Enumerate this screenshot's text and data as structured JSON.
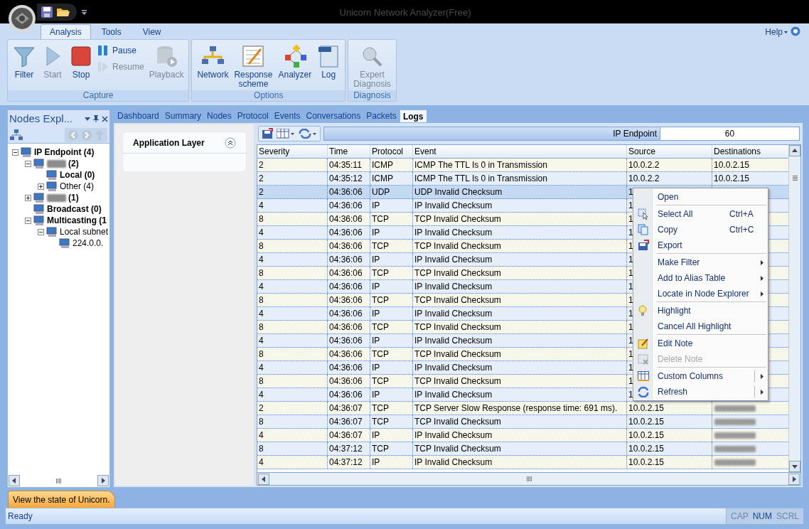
{
  "window": {
    "title": "Unicorn Network Analyzer(Free)"
  },
  "ribbon": {
    "tabs": [
      {
        "label": "Analysis",
        "selected": true
      },
      {
        "label": "Tools",
        "selected": false
      },
      {
        "label": "View",
        "selected": false
      }
    ],
    "help": "Help",
    "groups": [
      {
        "label": "Capture",
        "buttons": [
          {
            "label": "Filter",
            "kind": "large",
            "disabled": false
          },
          {
            "label": "Start",
            "kind": "large",
            "disabled": true
          },
          {
            "label": "Stop",
            "kind": "large",
            "disabled": false
          },
          {
            "label": "Pause",
            "kind": "small",
            "disabled": false
          },
          {
            "label": "Resume",
            "kind": "small",
            "disabled": true
          },
          {
            "label": "Playback",
            "kind": "large",
            "disabled": true
          }
        ]
      },
      {
        "label": "Options",
        "buttons": [
          {
            "label": "Network",
            "kind": "large",
            "disabled": false
          },
          {
            "label": "Response scheme",
            "kind": "large",
            "disabled": false
          },
          {
            "label": "Analyzer",
            "kind": "large",
            "disabled": false
          },
          {
            "label": "Log",
            "kind": "large",
            "disabled": false
          }
        ]
      },
      {
        "label": "Diagnosis",
        "buttons": [
          {
            "label": "Expert Diagnosis",
            "kind": "large",
            "disabled": true
          }
        ]
      }
    ]
  },
  "nodes_explorer": {
    "title": "Nodes Expl...",
    "tree": [
      {
        "label": "IP Endpoint (4)",
        "bold": true,
        "expanded": true,
        "children": [
          {
            "label": "(2)",
            "bold": true,
            "redacted": true,
            "expanded": true,
            "children": [
              {
                "label": "Local (0)",
                "bold": true
              },
              {
                "label": "Other (4)",
                "bold": false,
                "expanded": false
              }
            ]
          },
          {
            "label": "(1)",
            "bold": true,
            "redacted": true,
            "expanded": false
          },
          {
            "label": "Broadcast (0)",
            "bold": true
          },
          {
            "label": "Multicasting (1",
            "bold": true,
            "expanded": true,
            "children": [
              {
                "label": "Local subnet",
                "bold": false,
                "expanded": true,
                "children": [
                  {
                    "label": "224.0.0.",
                    "bold": false
                  }
                ]
              }
            ]
          }
        ]
      }
    ]
  },
  "view_tabs": [
    {
      "label": "Dashboard",
      "selected": false
    },
    {
      "label": "Summary",
      "selected": false
    },
    {
      "label": "Nodes",
      "selected": false
    },
    {
      "label": "Protocol",
      "selected": false
    },
    {
      "label": "Events",
      "selected": false
    },
    {
      "label": "Conversations",
      "selected": false
    },
    {
      "label": "Packets",
      "selected": false
    },
    {
      "label": "Logs",
      "selected": true
    }
  ],
  "side_panel": {
    "title": "Application Layer",
    "expanded": true
  },
  "logs": {
    "filter_label": "IP Endpoint",
    "filter_value": "60",
    "columns": [
      "Severity",
      "Time",
      "Protocol",
      "Event",
      "Source",
      "Destinations"
    ],
    "rows": [
      {
        "severity": "2",
        "time": "04:35:11",
        "protocol": "ICMP",
        "event": "ICMP The TTL Is 0 in Transmission",
        "source": "10.0.2.2",
        "destination": "10.0.2.15",
        "selected": false
      },
      {
        "severity": "2",
        "time": "04:35:12",
        "protocol": "ICMP",
        "event": "ICMP The TTL Is 0 in Transmission",
        "source": "10.0.2.2",
        "destination": "10.0.2.15",
        "selected": false
      },
      {
        "severity": "2",
        "time": "04:36:06",
        "protocol": "UDP",
        "event": "UDP Invalid Checksum",
        "source": "1",
        "selected": true
      },
      {
        "severity": "4",
        "time": "04:36:06",
        "protocol": "IP",
        "event": "IP Invalid Checksum",
        "source": "1",
        "selected": false
      },
      {
        "severity": "8",
        "time": "04:36:06",
        "protocol": "TCP",
        "event": "TCP Invalid Checksum",
        "source": "1",
        "selected": false
      },
      {
        "severity": "4",
        "time": "04:36:06",
        "protocol": "IP",
        "event": "IP Invalid Checksum",
        "source": "1",
        "selected": false
      },
      {
        "severity": "8",
        "time": "04:36:06",
        "protocol": "TCP",
        "event": "TCP Invalid Checksum",
        "source": "1",
        "selected": false
      },
      {
        "severity": "4",
        "time": "04:36:06",
        "protocol": "IP",
        "event": "IP Invalid Checksum",
        "source": "1",
        "selected": false
      },
      {
        "severity": "8",
        "time": "04:36:06",
        "protocol": "TCP",
        "event": "TCP Invalid Checksum",
        "source": "1",
        "selected": false
      },
      {
        "severity": "4",
        "time": "04:36:06",
        "protocol": "IP",
        "event": "IP Invalid Checksum",
        "source": "1",
        "selected": false
      },
      {
        "severity": "8",
        "time": "04:36:06",
        "protocol": "TCP",
        "event": "TCP Invalid Checksum",
        "source": "1",
        "selected": false
      },
      {
        "severity": "4",
        "time": "04:36:06",
        "protocol": "IP",
        "event": "IP Invalid Checksum",
        "source": "1",
        "selected": false
      },
      {
        "severity": "8",
        "time": "04:36:06",
        "protocol": "TCP",
        "event": "TCP Invalid Checksum",
        "source": "1",
        "selected": false
      },
      {
        "severity": "4",
        "time": "04:36:06",
        "protocol": "IP",
        "event": "IP Invalid Checksum",
        "source": "1",
        "selected": false
      },
      {
        "severity": "8",
        "time": "04:36:06",
        "protocol": "TCP",
        "event": "TCP Invalid Checksum",
        "source": "1",
        "selected": false
      },
      {
        "severity": "4",
        "time": "04:36:06",
        "protocol": "IP",
        "event": "IP Invalid Checksum",
        "source": "1",
        "selected": false
      },
      {
        "severity": "8",
        "time": "04:36:06",
        "protocol": "TCP",
        "event": "TCP Invalid Checksum",
        "source": "1",
        "selected": false
      },
      {
        "severity": "4",
        "time": "04:36:06",
        "protocol": "IP",
        "event": "IP Invalid Checksum",
        "source": "1",
        "selected": false
      },
      {
        "severity": "2",
        "time": "04:36:07",
        "protocol": "TCP",
        "event": "TCP Server Slow Response (response time: 691 ms).",
        "source": "10.0.2.15",
        "redacted": true,
        "selected": false
      },
      {
        "severity": "8",
        "time": "04:36:07",
        "protocol": "TCP",
        "event": "TCP Invalid Checksum",
        "source": "10.0.2.15",
        "redacted": true,
        "selected": false
      },
      {
        "severity": "4",
        "time": "04:36:07",
        "protocol": "IP",
        "event": "IP Invalid Checksum",
        "source": "10.0.2.15",
        "redacted": true,
        "selected": false
      },
      {
        "severity": "8",
        "time": "04:37:12",
        "protocol": "TCP",
        "event": "TCP Invalid Checksum",
        "source": "10.0.2.15",
        "redacted": true,
        "selected": false
      },
      {
        "severity": "4",
        "time": "04:37:12",
        "protocol": "IP",
        "event": "IP Invalid Checksum",
        "source": "10.0.2.15",
        "redacted": true,
        "selected": false
      }
    ]
  },
  "context_menu": [
    {
      "kind": "item",
      "label": "Open"
    },
    {
      "kind": "separator"
    },
    {
      "kind": "item",
      "label": "Select All",
      "shortcut": "Ctrl+A"
    },
    {
      "kind": "item",
      "label": "Copy",
      "shortcut": "Ctrl+C"
    },
    {
      "kind": "item",
      "label": "Export"
    },
    {
      "kind": "separator"
    },
    {
      "kind": "item",
      "label": "Make Filter",
      "submenu": true
    },
    {
      "kind": "item",
      "label": "Add to Alias Table",
      "submenu": true
    },
    {
      "kind": "item",
      "label": "Locate in Node Explorer",
      "submenu": true
    },
    {
      "kind": "separator"
    },
    {
      "kind": "item",
      "label": "Highlight"
    },
    {
      "kind": "item",
      "label": "Cancel All Highlight"
    },
    {
      "kind": "separator"
    },
    {
      "kind": "item",
      "label": "Edit Note"
    },
    {
      "kind": "item",
      "label": "Delete Note",
      "disabled": true
    },
    {
      "kind": "separator"
    },
    {
      "kind": "item",
      "label": "Custom Columns",
      "submenu": true,
      "split": true
    },
    {
      "kind": "item",
      "label": "Refresh",
      "submenu": true,
      "split": true
    }
  ],
  "doc_tab": "View the state of Unicorn.",
  "status_bar": {
    "text": "Ready",
    "indicators": [
      {
        "label": "CAP",
        "on": false
      },
      {
        "label": "NUM",
        "on": true
      },
      {
        "label": "SCRL",
        "on": false
      }
    ]
  }
}
